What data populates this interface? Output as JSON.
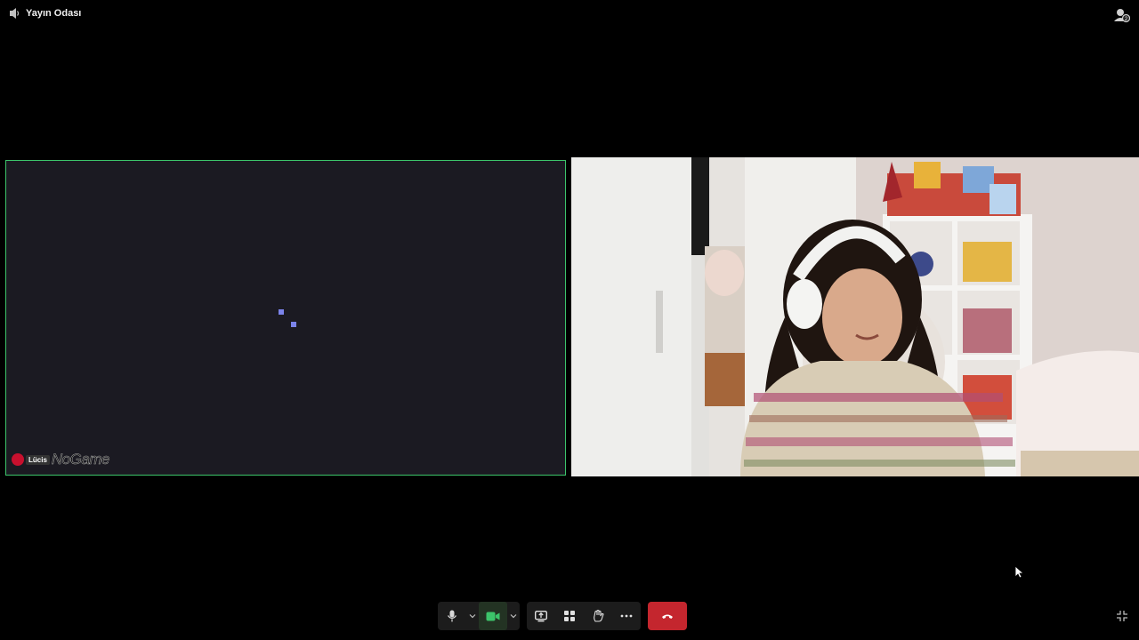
{
  "window": {
    "room_name": "Yayın Odası"
  },
  "tiles": {
    "left": {
      "participant_label": "Lücis",
      "overlay_brand": "NoGame"
    }
  },
  "colors": {
    "active_border": "#3cc46a",
    "loader": "#7b83ea",
    "leave_button": "#c4262e",
    "camera_on": "#3cc46a"
  },
  "controls": {
    "items": [
      {
        "name": "microphone",
        "icon": "mic-icon"
      },
      {
        "name": "camera",
        "icon": "video-camera-icon"
      },
      {
        "name": "share",
        "icon": "share-screen-icon"
      },
      {
        "name": "view",
        "icon": "grid-view-icon"
      },
      {
        "name": "reactions",
        "icon": "raise-hand-icon"
      },
      {
        "name": "more",
        "icon": "more-icon"
      },
      {
        "name": "leave",
        "icon": "hang-up-icon"
      }
    ]
  }
}
